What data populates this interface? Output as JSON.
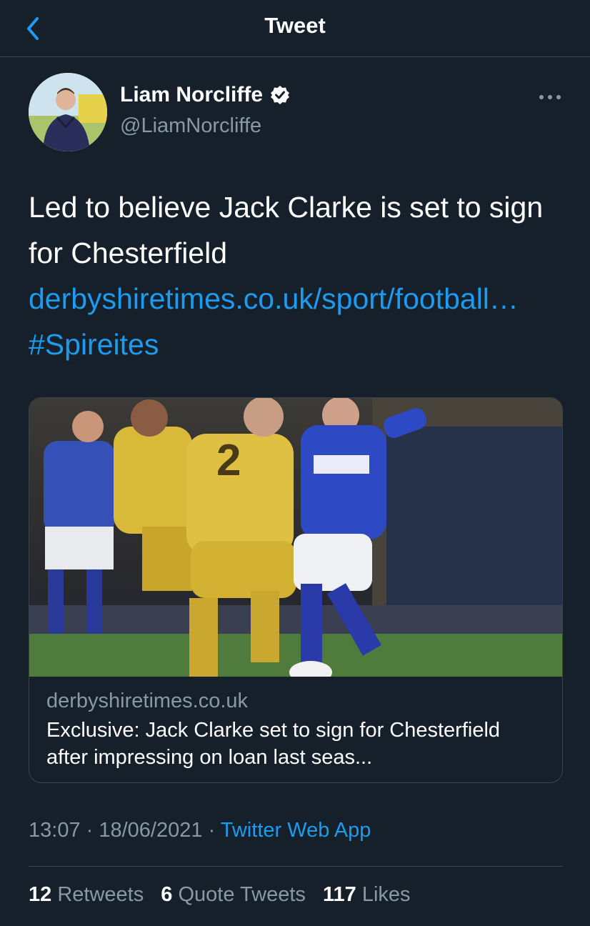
{
  "header": {
    "title": "Tweet",
    "back_icon": "chevron-left-icon"
  },
  "author": {
    "name": "Liam Norcliffe",
    "handle": "@LiamNorcliffe",
    "verified_icon": "verified-badge-icon",
    "more_icon": "more-horizontal-icon"
  },
  "tweet": {
    "text": "Led to believe Jack Clarke is set to sign for Chesterfield",
    "link": "derbyshiretimes.co.uk/sport/football…",
    "hashtag": "#Spireites"
  },
  "card": {
    "image_icon": "football-match-photo",
    "domain": "derbyshiretimes.co.uk",
    "title": "Exclusive: Jack Clarke set to sign for Chesterfield after impressing on loan last seas..."
  },
  "meta": {
    "time": "13:07",
    "separator": " · ",
    "date": "18/06/2021",
    "source": "Twitter Web App"
  },
  "stats": {
    "retweets_count": "12",
    "retweets_label": "Retweets",
    "quotes_count": "6",
    "quotes_label": "Quote Tweets",
    "likes_count": "117",
    "likes_label": "Likes"
  },
  "colors": {
    "background": "#15202b",
    "accent": "#1d9bf0",
    "muted": "#8899a6",
    "border": "#38444d"
  }
}
